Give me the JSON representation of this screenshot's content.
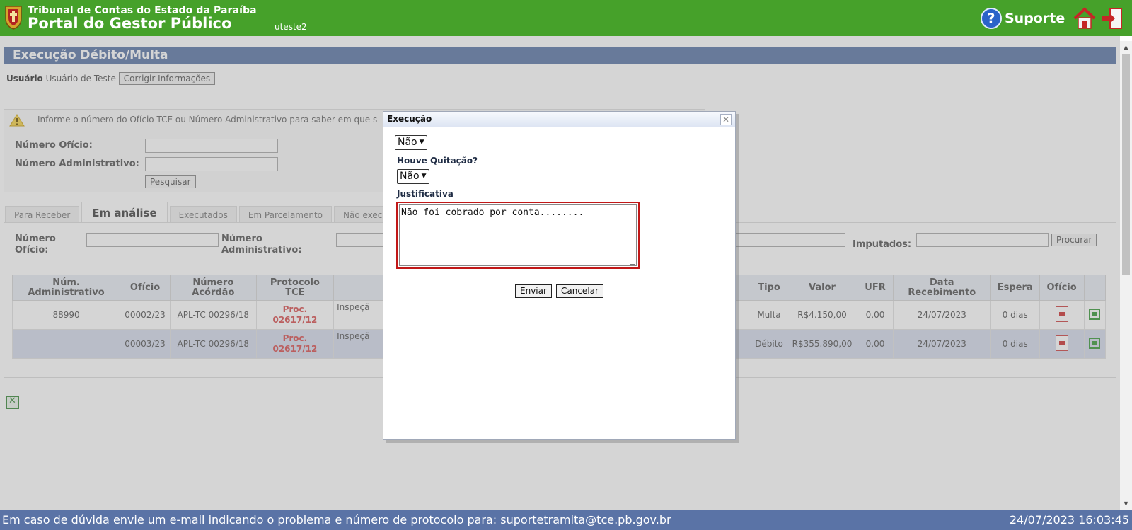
{
  "header": {
    "org": "Tribunal de Contas do Estado da Paraíba",
    "portal": "Portal do Gestor Público",
    "user": "uteste2",
    "support": "Suporte",
    "accent": "#46a12a"
  },
  "page": {
    "title": "Execução Débito/Multa",
    "usuario_label": "Usuário",
    "usuario_value": "Usuário de Teste",
    "corrigir_button": "Corrigir Informações",
    "info_message": "Informe o número do Ofício TCE ou Número Administrativo para saber em que s",
    "numero_oficio_label": "Número Ofício:",
    "numero_admin_label": "Número Administrativo:",
    "pesquisar_button": "Pesquisar"
  },
  "tabs": [
    {
      "label": "Para Receber"
    },
    {
      "label": "Em análise"
    },
    {
      "label": "Executados"
    },
    {
      "label": "Em Parcelamento"
    },
    {
      "label": "Não executa"
    }
  ],
  "filters": {
    "numero_oficio": "Número Ofício:",
    "numero_admin": "Número Administrativo:",
    "imputados": "Imputados:",
    "procurar_button": "Procurar"
  },
  "table": {
    "headers": {
      "num_admin": "Núm. Administrativo",
      "oficio": "Ofício",
      "numero_acordao": "Número Acórdão",
      "protocolo": "Protocolo TCE",
      "tipo": "Tipo",
      "valor": "Valor",
      "ufr": "UFR",
      "data": "Data Recebimento",
      "espera": "Espera",
      "oficio_doc": "Ofício"
    },
    "rows": [
      {
        "num_admin": "88990",
        "oficio": "00002/23",
        "acordao": "APL-TC 00296/18",
        "proc_1": "Proc.",
        "proc_2": "02617/12",
        "desc": "Inspeçã",
        "tipo": "Multa",
        "valor": "R$4.150,00",
        "ufr": "0,00",
        "data": "24/07/2023",
        "espera": "0 dias"
      },
      {
        "num_admin": "",
        "oficio": "00003/23",
        "acordao": "APL-TC 00296/18",
        "proc_1": "Proc.",
        "proc_2": "02617/12",
        "desc": "Inspeçã",
        "tipo": "Débito",
        "valor": "R$355.890,00",
        "ufr": "0,00",
        "data": "24/07/2023",
        "espera": "0 dias"
      }
    ]
  },
  "dialog": {
    "title": "Execução",
    "select_1": "Não",
    "quitacao_label": "Houve Quitação?",
    "select_2": "Não",
    "justificativa_label": "Justificativa",
    "justificativa_text": "Não foi cobrado por conta........",
    "enviar_button": "Enviar",
    "cancelar_button": "Cancelar"
  },
  "footer": {
    "text": "Em caso de dúvida envie um e-mail indicando o problema e número de protocolo para: suportetramita@tce.pb.gov.br",
    "datetime": "24/07/2023 16:03:45"
  }
}
